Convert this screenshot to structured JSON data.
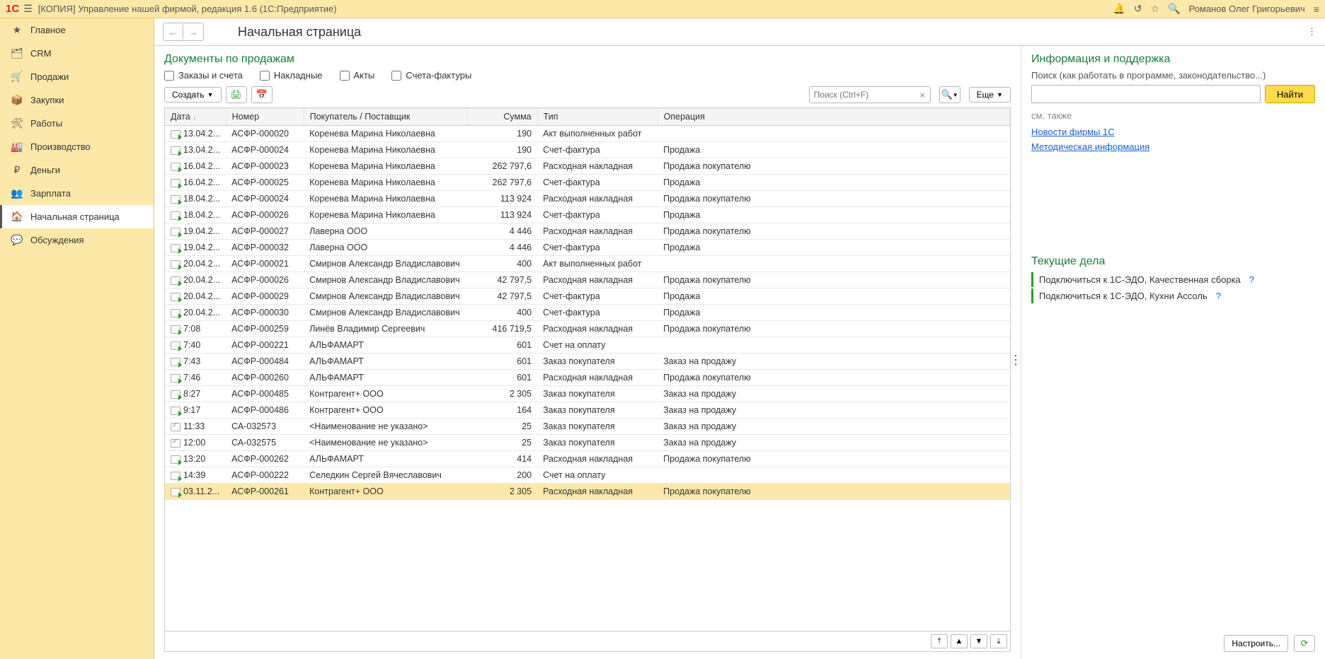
{
  "titlebar": {
    "app_title": "[КОПИЯ] Управление нашей фирмой, редакция 1.6  (1С:Предприятие)",
    "username": "Романов Олег Григорьевич"
  },
  "sidebar": {
    "items": [
      {
        "label": "Главное",
        "icon": "★"
      },
      {
        "label": "CRM",
        "icon": "🗂"
      },
      {
        "label": "Продажи",
        "icon": "🛒"
      },
      {
        "label": "Закупки",
        "icon": "📦"
      },
      {
        "label": "Работы",
        "icon": "🛠"
      },
      {
        "label": "Производство",
        "icon": "🏭"
      },
      {
        "label": "Деньги",
        "icon": "₽"
      },
      {
        "label": "Зарплата",
        "icon": "👥"
      },
      {
        "label": "Начальная страница",
        "icon": "🏠",
        "active": true
      },
      {
        "label": "Обсуждения",
        "icon": "💬"
      }
    ]
  },
  "header": {
    "page_title": "Начальная страница"
  },
  "docs": {
    "heading": "Документы по продажам",
    "filters": {
      "orders": "Заказы и счета",
      "waybills": "Накладные",
      "acts": "Акты",
      "invoices": "Счета-фактуры"
    },
    "create_btn": "Создать",
    "search_placeholder": "Поиск (Ctrl+F)",
    "more_btn": "Еще",
    "columns": {
      "date": "Дата",
      "number": "Номер",
      "buyer": "Покупатель / Поставщик",
      "sum": "Сумма",
      "type": "Тип",
      "operation": "Операция"
    },
    "rows": [
      {
        "date": "13.04.2...",
        "number": "АСФР-000020",
        "buyer": "Коренева Марина Николаевна",
        "sum": "190",
        "type": "Акт выполненных работ",
        "op": "",
        "ic": "green"
      },
      {
        "date": "13.04.2...",
        "number": "АСФР-000024",
        "buyer": "Коренева Марина Николаевна",
        "sum": "190",
        "type": "Счет-фактура",
        "op": "Продажа",
        "ic": "green"
      },
      {
        "date": "16.04.2...",
        "number": "АСФР-000023",
        "buyer": "Коренева Марина Николаевна",
        "sum": "262 797,6",
        "type": "Расходная накладная",
        "op": "Продажа покупателю",
        "ic": "green"
      },
      {
        "date": "16.04.2...",
        "number": "АСФР-000025",
        "buyer": "Коренева Марина Николаевна",
        "sum": "262 797,6",
        "type": "Счет-фактура",
        "op": "Продажа",
        "ic": "green"
      },
      {
        "date": "18.04.2...",
        "number": "АСФР-000024",
        "buyer": "Коренева Марина Николаевна",
        "sum": "113 924",
        "type": "Расходная накладная",
        "op": "Продажа покупателю",
        "ic": "green"
      },
      {
        "date": "18.04.2...",
        "number": "АСФР-000026",
        "buyer": "Коренева Марина Николаевна",
        "sum": "113 924",
        "type": "Счет-фактура",
        "op": "Продажа",
        "ic": "green"
      },
      {
        "date": "19.04.2...",
        "number": "АСФР-000027",
        "buyer": "Лаверна ООО",
        "sum": "4 446",
        "type": "Расходная накладная",
        "op": "Продажа покупателю",
        "ic": "green"
      },
      {
        "date": "19.04.2...",
        "number": "АСФР-000032",
        "buyer": "Лаверна ООО",
        "sum": "4 446",
        "type": "Счет-фактура",
        "op": "Продажа",
        "ic": "green"
      },
      {
        "date": "20.04.2...",
        "number": "АСФР-000021",
        "buyer": "Смирнов Александр Владиславович",
        "sum": "400",
        "type": "Акт выполненных работ",
        "op": "",
        "ic": "green"
      },
      {
        "date": "20.04.2...",
        "number": "АСФР-000026",
        "buyer": "Смирнов Александр Владиславович",
        "sum": "42 797,5",
        "type": "Расходная накладная",
        "op": "Продажа покупателю",
        "ic": "green"
      },
      {
        "date": "20.04.2...",
        "number": "АСФР-000029",
        "buyer": "Смирнов Александр Владиславович",
        "sum": "42 797,5",
        "type": "Счет-фактура",
        "op": "Продажа",
        "ic": "green"
      },
      {
        "date": "20.04.2...",
        "number": "АСФР-000030",
        "buyer": "Смирнов Александр Владиславович",
        "sum": "400",
        "type": "Счет-фактура",
        "op": "Продажа",
        "ic": "green"
      },
      {
        "date": "7:08",
        "number": "АСФР-000259",
        "buyer": "Линёв Владимир Сергеевич",
        "sum": "416 719,5",
        "type": "Расходная накладная",
        "op": "Продажа покупателю",
        "ic": "green"
      },
      {
        "date": "7:40",
        "number": "АСФР-000221",
        "buyer": "АЛЬФАМАРТ",
        "sum": "601",
        "type": "Счет на оплату",
        "op": "",
        "ic": "green"
      },
      {
        "date": "7:43",
        "number": "АСФР-000484",
        "buyer": "АЛЬФАМАРТ",
        "sum": "601",
        "type": "Заказ покупателя",
        "op": "Заказ на продажу",
        "ic": "green"
      },
      {
        "date": "7:46",
        "number": "АСФР-000260",
        "buyer": "АЛЬФАМАРТ",
        "sum": "601",
        "type": "Расходная накладная",
        "op": "Продажа покупателю",
        "ic": "green"
      },
      {
        "date": "8:27",
        "number": "АСФР-000485",
        "buyer": "Контрагент+ ООО",
        "sum": "2 305",
        "type": "Заказ покупателя",
        "op": "Заказ на продажу",
        "ic": "green"
      },
      {
        "date": "9:17",
        "number": "АСФР-000486",
        "buyer": "Контрагент+ ООО",
        "sum": "164",
        "type": "Заказ покупателя",
        "op": "Заказ на продажу",
        "ic": "green"
      },
      {
        "date": "11:33",
        "number": "СА-032573",
        "buyer": "<Наименование не указано>",
        "sum": "25",
        "type": "Заказ покупателя",
        "op": "Заказ на продажу",
        "ic": "check"
      },
      {
        "date": "12:00",
        "number": "СА-032575",
        "buyer": "<Наименование не указано>",
        "sum": "25",
        "type": "Заказ покупателя",
        "op": "Заказ на продажу",
        "ic": "check"
      },
      {
        "date": "13:20",
        "number": "АСФР-000262",
        "buyer": "АЛЬФАМАРТ",
        "sum": "414",
        "type": "Расходная накладная",
        "op": "Продажа покупателю",
        "ic": "green"
      },
      {
        "date": "14:39",
        "number": "АСФР-000222",
        "buyer": "Селедкин Сергей Вячеславович",
        "sum": "200",
        "type": "Счет на оплату",
        "op": "",
        "ic": "green"
      },
      {
        "date": "03.11.2...",
        "number": "АСФР-000261",
        "buyer": "Контрагент+ ООО",
        "sum": "2 305",
        "type": "Расходная накладная",
        "op": "Продажа покупателю",
        "ic": "green",
        "selected": true
      }
    ]
  },
  "info": {
    "heading": "Информация и поддержка",
    "search_caption": "Поиск (как работать в программе, законодательство...)",
    "find_btn": "Найти",
    "seealso": "см. также",
    "link1": "Новости фирмы 1С",
    "link2": "Методическая информация"
  },
  "tasks": {
    "heading": "Текущие дела",
    "items": [
      "Подключиться к 1С-ЭДО, Качественная сборка",
      "Подключиться к 1С-ЭДО, Кухни Ассоль"
    ]
  },
  "footer": {
    "configure": "Настроить..."
  }
}
